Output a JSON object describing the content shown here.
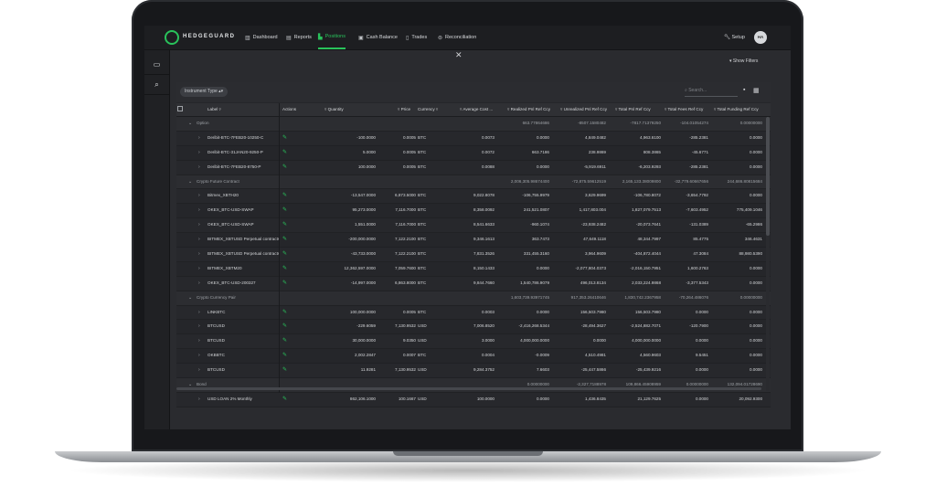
{
  "app": {
    "name": "HEDGEGUARD",
    "avatar": "HA"
  },
  "nav": [
    {
      "label": "Dashboard",
      "icon": "chart-bar-icon"
    },
    {
      "label": "Reports",
      "icon": "report-icon"
    },
    {
      "label": "Positions",
      "icon": "positions-icon",
      "active": true
    },
    {
      "label": "Cash Balance",
      "icon": "cash-icon"
    },
    {
      "label": "Trades",
      "icon": "trades-icon"
    },
    {
      "label": "Reconciliation",
      "icon": "reconciliation-icon"
    }
  ],
  "setup_label": "Setup",
  "show_filters": "Show Filters",
  "filter_chip": "Instrument Type",
  "search_placeholder": "Search...",
  "columns": [
    "Label",
    "Actions",
    "Quantity",
    "Price",
    "Currency",
    "Average Cost ...",
    "Realized Pnl Ref Ccy",
    "Unrealized Pnl Ref Ccy",
    "Total Pnl Ref Ccy",
    "Total Fees Ref Ccy",
    "Total Funding Ref Ccy"
  ],
  "rows": [
    {
      "type": "group",
      "label": "Option",
      "realized": "663.77864686",
      "unrealized": "-8507.1580482",
      "total": "-7817.71379250",
      "fees": "-104.01054274",
      "funding": "0.00000000"
    },
    {
      "type": "item",
      "label": "Deribit-BTC-7FEB20-10250-C",
      "qty": "-100.0000",
      "price": "0.0005",
      "ccy": "BTC",
      "avg": "0.0073",
      "realized": "0.0000",
      "unrealized": "4,849.0482",
      "total": "4,963.6100",
      "fees": "-285.2381",
      "funding": "0.0000"
    },
    {
      "type": "item",
      "label": "Deribit-BTC-31JAN20-9250-P",
      "qty": "5.0000",
      "price": "0.0005",
      "ccy": "BTC",
      "avg": "0.0072",
      "realized": "663.7186",
      "unrealized": "238.9869",
      "total": "808.3865",
      "fees": "-45.6771",
      "funding": "0.0000"
    },
    {
      "type": "item",
      "label": "Deribit-BTC-7FEB20-8750-P",
      "qty": "100.0000",
      "price": "0.0005",
      "ccy": "BTC",
      "avg": "0.0088",
      "realized": "0.0000",
      "unrealized": "-5,919.6911",
      "total": "-6,203.9293",
      "fees": "-285.2381",
      "funding": "0.0000"
    },
    {
      "type": "group",
      "label": "Crypto Future Contract",
      "realized": "2,006,305.98674400",
      "unrealized": "-72,875.59612519",
      "total": "2,165,133.38009800",
      "fees": "-32,779.60667656",
      "funding": "244,686.80815684"
    },
    {
      "type": "item",
      "label": "Bitmex_XBTH20",
      "qty": "-13,547.0000",
      "price": "6,873.5000",
      "ccy": "BTC",
      "avg": "9,022.8078",
      "realized": "-106,755.9979",
      "unrealized": "3,629.9699",
      "total": "-106,780.8072",
      "fees": "-3,654.7792",
      "funding": "0.0000"
    },
    {
      "type": "item",
      "label": "OKEX_BTC-USD-SWAP",
      "qty": "95,273.0000",
      "price": "7,116.7000",
      "ccy": "BTC",
      "avg": "8,358.0092",
      "realized": "241,521.0807",
      "unrealized": "1,417,803.004",
      "total": "1,827,079.7513",
      "fees": "-7,603.4952",
      "funding": "775,409.1046"
    },
    {
      "type": "item",
      "label": "OKEX_BTC-USD-SWAP",
      "qty": "1,551.0000",
      "price": "7,116.7000",
      "ccy": "BTC",
      "avg": "8,541.6633",
      "realized": "-960.1074",
      "unrealized": "-23,938.2482",
      "total": "-20,073.7641",
      "fees": "-131.0389",
      "funding": "-65.2986"
    },
    {
      "type": "item",
      "label": "BITMEX_XBTUSD Perpetual contracts",
      "qty": "-200,000.0000",
      "price": "7,122.2100",
      "ccy": "BTC",
      "avg": "9,346.1613",
      "realized": "363.7473",
      "unrealized": "47,649.1118",
      "total": "48,344.7997",
      "fees": "85.4775",
      "funding": "346.4631"
    },
    {
      "type": "item",
      "label": "BITMEX_XBTUSD Perpetual contracts",
      "qty": "-43,733.0000",
      "price": "7,122.2100",
      "ccy": "BTC",
      "avg": "7,831.3526",
      "realized": "331,455.3160",
      "unrealized": "3,964.9609",
      "total": "-404,872.4044",
      "fees": "47.3084",
      "funding": "88,980.5390"
    },
    {
      "type": "item",
      "label": "BITMEX_XBTM20",
      "qty": "12,362,597.0000",
      "price": "7,059.7600",
      "ccy": "BTC",
      "avg": "8,150.1433",
      "realized": "0.0000",
      "unrealized": "-2,077,804.0373",
      "total": "-2,016,150.7951",
      "fees": "1,600.2763",
      "funding": "0.0000"
    },
    {
      "type": "item",
      "label": "OKEX_BTC-USD-200327",
      "qty": "-14,997.0000",
      "price": "6,863.8000",
      "ccy": "BTC",
      "avg": "9,844.7660",
      "realized": "1,540,786.9079",
      "unrealized": "496,013.8134",
      "total": "2,033,224.9868",
      "fees": "-3,377.5343",
      "funding": "0.0000"
    },
    {
      "type": "group",
      "label": "Crypto Currency Pair",
      "realized": "1,603,739.93971745",
      "unrealized": "917,353.26410646",
      "total": "1,830,742.2367958",
      "fees": "-70,264.486076",
      "funding": "0.00000000"
    },
    {
      "type": "item",
      "label": "LINKBTC",
      "qty": "100,000.0000",
      "price": "0.0005",
      "ccy": "BTC",
      "avg": "0.0003",
      "realized": "0.0000",
      "unrealized": "156,503.7980",
      "total": "156,503.7980",
      "fees": "0.0000",
      "funding": "0.0000"
    },
    {
      "type": "item",
      "label": "BTCUSD",
      "qty": "-229.6059",
      "price": "7,130.9532",
      "ccy": "USD",
      "avg": "7,006.8520",
      "realized": "-2,416,268.5344",
      "unrealized": "-28,494.3627",
      "total": "-2,524,882.7071",
      "fees": "-120.7900",
      "funding": "0.0000"
    },
    {
      "type": "item",
      "label": "BTCUSD",
      "qty": "30,000.0000",
      "price": "9.0350",
      "ccy": "USD",
      "avg": "3.0000",
      "realized": "4,000,000.0000",
      "unrealized": "0.0000",
      "total": "4,000,000.0000",
      "fees": "0.0000",
      "funding": "0.0000"
    },
    {
      "type": "item",
      "label": "OKBBTC",
      "qty": "2,002.2847",
      "price": "0.0007",
      "ccy": "BTC",
      "avg": "0.0004",
      "realized": "-0.0009",
      "unrealized": "4,510.4981",
      "total": "4,560.9603",
      "fees": "9.5451",
      "funding": "0.0000"
    },
    {
      "type": "item",
      "label": "BTCUSD",
      "qty": "11.9281",
      "price": "7,130.9532",
      "ccy": "USD",
      "avg": "9,284.3752",
      "realized": "7.6603",
      "unrealized": "-25,447.5866",
      "total": "-25,439.9216",
      "fees": "0.0000",
      "funding": "0.0000"
    },
    {
      "type": "group",
      "label": "Bond",
      "realized": "0.00000000",
      "unrealized": "-2,327,7188978",
      "total": "109,866.45908959",
      "fees": "0.00000000",
      "funding": "132,094.01728690"
    },
    {
      "type": "item",
      "label": "USD LOAN 2% Monthly",
      "qty": "862,106.1000",
      "price": "100.1667",
      "ccy": "USD",
      "avg": "100.0000",
      "realized": "0.0000",
      "unrealized": "1,436.8435",
      "total": "21,129.7625",
      "fees": "0.0000",
      "funding": "20,092.9300"
    }
  ],
  "colors": {
    "accent": "#29c25b",
    "background": "#2a2b2f"
  }
}
